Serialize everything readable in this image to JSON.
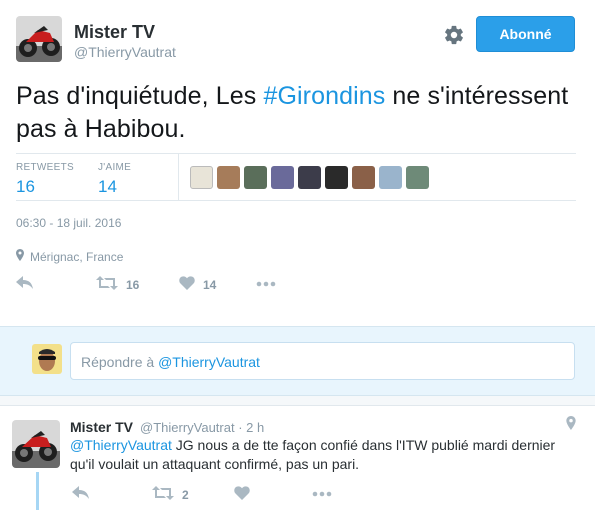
{
  "author": {
    "name": "Mister TV",
    "handle": "@ThierryVautrat"
  },
  "follow_button": "Abonné",
  "tweet": {
    "text_before": "Pas d'inquiétude, Les ",
    "hashtag": "#Girondins",
    "text_after": " ne s'intéressent pas à Habibou.",
    "retweets_label": "RETWEETS",
    "retweets_value": "16",
    "likes_label": "J'AIME",
    "likes_value": "14",
    "date": "06:30 - 18 juil. 2016",
    "location": "Mérignac, France",
    "action_retweet_count": "16",
    "action_like_count": "14"
  },
  "reply_box": {
    "placeholder_prefix": "Répondre à ",
    "placeholder_mention": "@ThierryVautrat"
  },
  "reply_tweet": {
    "name": "Mister TV",
    "meta": "@ThierryVautrat · 2 h",
    "mention": "@ThierryVautrat",
    "text": " JG nous a de tte façon confié dans l'ITW publié mardi dernier qu'il voulait un attaquant confirmé, pas un pari.",
    "retweet_count": "2"
  },
  "icons": {
    "gear": "gear-icon",
    "reply": "reply-icon",
    "retweet": "retweet-icon",
    "like": "heart-icon",
    "more": "more-icon",
    "location": "location-pin-icon"
  },
  "colors": {
    "accent": "#1b95e0",
    "follow_button": "#2b9fe9",
    "muted": "#8899a6"
  }
}
